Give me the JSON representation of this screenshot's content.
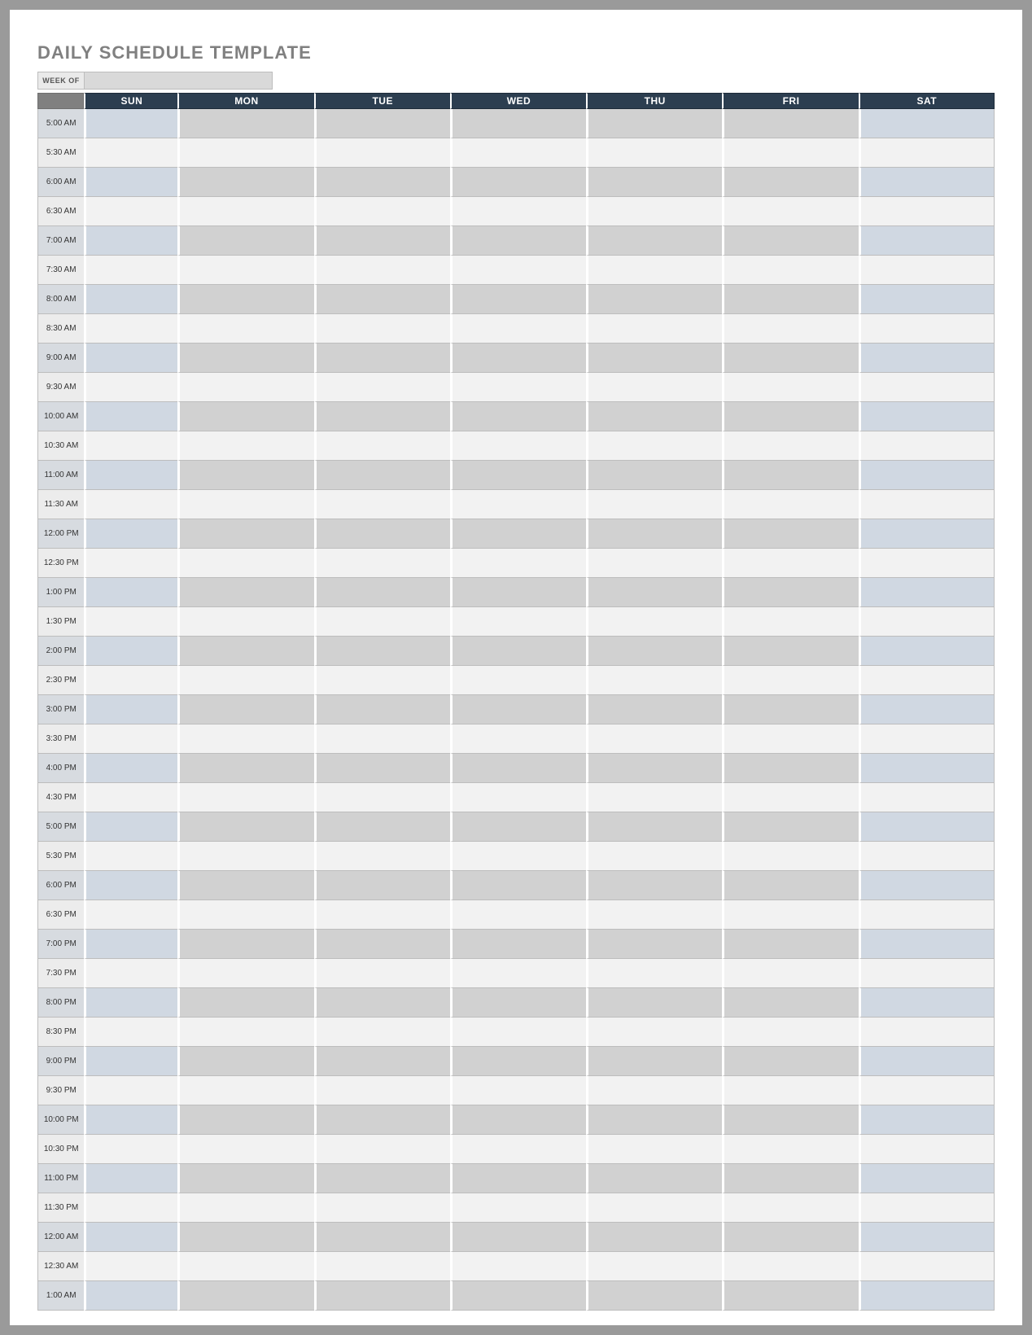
{
  "title": "DAILY SCHEDULE TEMPLATE",
  "weekof": {
    "label": "WEEK OF",
    "value": ""
  },
  "days": [
    "SUN",
    "MON",
    "TUE",
    "WED",
    "THU",
    "FRI",
    "SAT"
  ],
  "times": [
    "5:00 AM",
    "5:30 AM",
    "6:00 AM",
    "6:30 AM",
    "7:00 AM",
    "7:30 AM",
    "8:00 AM",
    "8:30 AM",
    "9:00 AM",
    "9:30 AM",
    "10:00 AM",
    "10:30 AM",
    "11:00 AM",
    "11:30 AM",
    "12:00 PM",
    "12:30 PM",
    "1:00 PM",
    "1:30 PM",
    "2:00 PM",
    "2:30 PM",
    "3:00 PM",
    "3:30 PM",
    "4:00 PM",
    "4:30 PM",
    "5:00 PM",
    "5:30 PM",
    "6:00 PM",
    "6:30 PM",
    "7:00 PM",
    "7:30 PM",
    "8:00 PM",
    "8:30 PM",
    "9:00 PM",
    "9:30 PM",
    "10:00 PM",
    "10:30 PM",
    "11:00 PM",
    "11:30 PM",
    "12:00 AM",
    "12:30 AM",
    "1:00 AM"
  ],
  "colors": {
    "frame_border": "#9a9a9a",
    "title_text": "#808080",
    "header_bg": "#2c3e50",
    "header_corner_bg": "#808080",
    "shaded_time_bg": "#d7dbe0",
    "shaded_cell_bg": "#d1d1d1",
    "shaded_weekend_bg": "#d0d8e2",
    "plain_time_bg": "#ececec",
    "plain_cell_bg": "#f2f2f2",
    "grid_border": "#bdbdbd",
    "col_gap": "#ffffff"
  }
}
